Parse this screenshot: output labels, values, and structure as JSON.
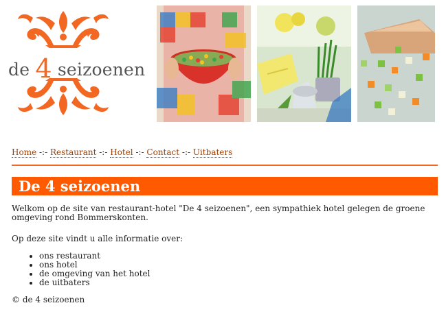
{
  "logo": {
    "prefix": "de ",
    "number": "4",
    "suffix": " seizoenen",
    "ornament_color": "#f26722"
  },
  "nav": {
    "items": [
      {
        "label": "Home"
      },
      {
        "label": "Restaurant"
      },
      {
        "label": "Hotel"
      },
      {
        "label": "Contact"
      },
      {
        "label": "Uitbaters"
      }
    ],
    "separator": " -:- "
  },
  "main": {
    "title": "De 4 seizoenen",
    "welcome": "Welkom op de site van restaurant-hotel \"De 4 seizoenen\", een sympathiek hotel gelegen de groene omgeving rond Bommerskonten.",
    "intro": "Op deze site vindt u alle informatie over:",
    "list": [
      "ons restaurant",
      "ons hotel",
      "de omgeving van het hotel",
      "de uitbaters"
    ],
    "footer": "© de 4 seizoenen"
  },
  "colors": {
    "accent": "#ff5a00",
    "link": "#a04000"
  }
}
